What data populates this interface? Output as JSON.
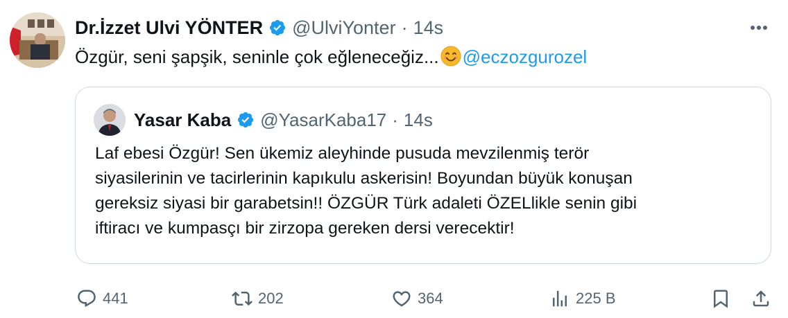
{
  "tweet": {
    "author_name": "Dr.İzzet Ulvi YÖNTER",
    "handle": "@UlviYonter",
    "separator": "·",
    "time": "14s",
    "text": "Özgür, seni şapşik, seninle çok eğleneceğiz...",
    "emoji": "smiling-face-emoji",
    "mention": "@eczozgurozel"
  },
  "quote": {
    "author_name": "Yasar Kaba",
    "handle": "@YasarKaba17",
    "separator": "·",
    "time": "14s",
    "lines": [
      "Laf ebesi Özgür! Sen ükemiz aleyhinde pusuda mevzilenmiş terör",
      "siyasilerinin ve tacirlerinin kapıkulu askerisin! Boyundan büyük konuşan",
      "gereksiz siyasi bir garabetsin!! ÖZGÜR Türk adaleti ÖZELlikle senin gibi",
      "iftiracı ve kumpasçı bir zirzopa gereken dersi verecektir!"
    ]
  },
  "actions": {
    "replies": "441",
    "retweets": "202",
    "likes": "364",
    "views": "225 B"
  },
  "colors": {
    "accent": "#1d9bf0",
    "text": "#0f1419",
    "secondary": "#536471",
    "border": "#cfd9de"
  }
}
